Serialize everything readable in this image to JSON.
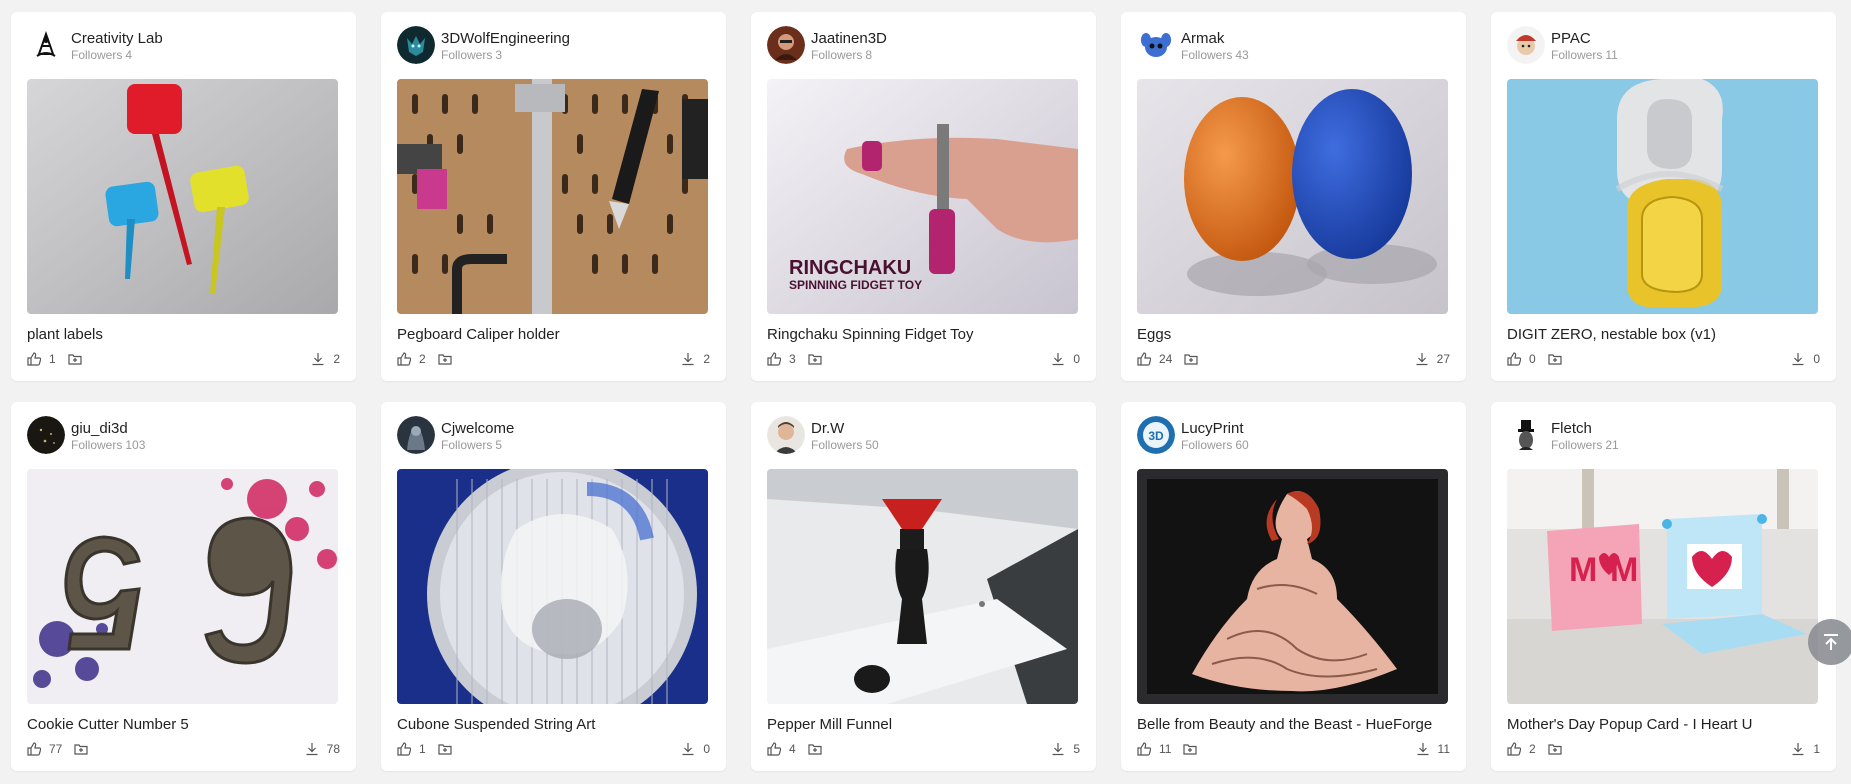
{
  "cards": [
    {
      "author": "Creativity Lab",
      "followers_label": "Followers",
      "followers": "4",
      "title": "plant labels",
      "likes": "1",
      "downloads": "2"
    },
    {
      "author": "3DWolfEngineering",
      "followers_label": "Followers",
      "followers": "3",
      "title": "Pegboard Caliper holder",
      "likes": "2",
      "downloads": "2"
    },
    {
      "author": "Jaatinen3D",
      "followers_label": "Followers",
      "followers": "8",
      "title": "Ringchaku Spinning Fidget Toy",
      "likes": "3",
      "downloads": "0",
      "image_text_1": "RINGCHAKU",
      "image_text_2": "SPINNING FIDGET TOY"
    },
    {
      "author": "Armak",
      "followers_label": "Followers",
      "followers": "43",
      "title": "Eggs",
      "likes": "24",
      "downloads": "27"
    },
    {
      "author": "PPAC",
      "followers_label": "Followers",
      "followers": "11",
      "title": "DIGIT ZERO, nestable box (v1)",
      "likes": "0",
      "downloads": "0"
    },
    {
      "author": "giu_di3d",
      "followers_label": "Followers",
      "followers": "103",
      "title": "Cookie Cutter Number 5",
      "likes": "77",
      "downloads": "78"
    },
    {
      "author": "Cjwelcome",
      "followers_label": "Followers",
      "followers": "5",
      "title": "Cubone Suspended String Art",
      "likes": "1",
      "downloads": "0"
    },
    {
      "author": "Dr.W",
      "followers_label": "Followers",
      "followers": "50",
      "title": "Pepper Mill Funnel",
      "likes": "4",
      "downloads": "5"
    },
    {
      "author": "LucyPrint",
      "followers_label": "Followers",
      "followers": "60",
      "title": "Belle from Beauty and the Beast - HueForge",
      "likes": "11",
      "downloads": "11"
    },
    {
      "author": "Fletch",
      "followers_label": "Followers",
      "followers": "21",
      "title": "Mother's Day Popup Card - I Heart U",
      "likes": "2",
      "downloads": "1",
      "image_text_1": "M",
      "image_text_2": "M"
    }
  ],
  "icons": {
    "like": "thumbs-up-icon",
    "collect": "collect-icon",
    "download": "download-icon",
    "back_to_top": "back-to-top-icon"
  }
}
